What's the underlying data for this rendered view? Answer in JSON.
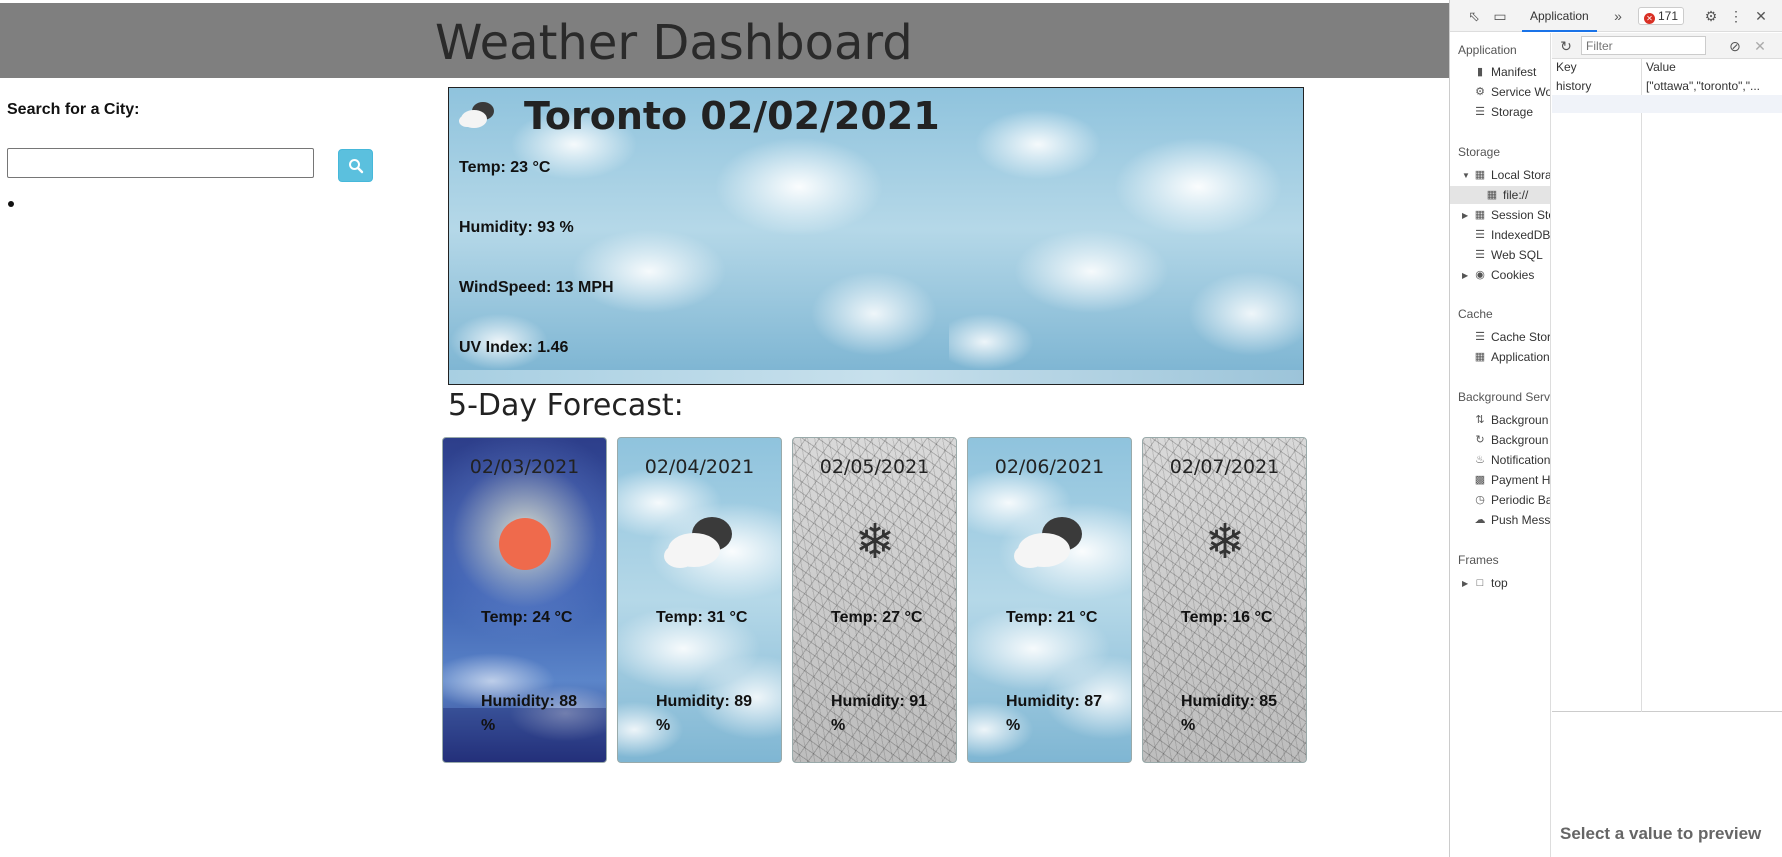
{
  "header": {
    "title": "Weather Dashboard"
  },
  "search": {
    "label": "Search for a City:",
    "placeholder": "",
    "value": "",
    "button_icon": "search-icon"
  },
  "current": {
    "title": "Toronto 02/02/2021",
    "icon": "cloud-icon",
    "temp": "Temp: 23 °C",
    "humidity": "Humidity: 93 %",
    "wind": "WindSpeed: 13 MPH",
    "uv": "UV Index: 1.46"
  },
  "forecast": {
    "title": "5-Day Forecast:",
    "days": [
      {
        "date": "02/03/2021",
        "icon": "sun-icon",
        "temp": "Temp: 24 °C",
        "humidity": "Humidity: 88 %",
        "theme": "sunny"
      },
      {
        "date": "02/04/2021",
        "icon": "cloud-icon",
        "temp": "Temp: 31 °C",
        "humidity": "Humidity: 89 %",
        "theme": "sky"
      },
      {
        "date": "02/05/2021",
        "icon": "snowflake-icon",
        "temp": "Temp: 27 °C",
        "humidity": "Humidity: 91 %",
        "theme": "snow"
      },
      {
        "date": "02/06/2021",
        "icon": "cloud-icon",
        "temp": "Temp: 21 °C",
        "humidity": "Humidity: 87 %",
        "theme": "sky"
      },
      {
        "date": "02/07/2021",
        "icon": "snowflake-icon",
        "temp": "Temp: 16 °C",
        "humidity": "Humidity: 85 %",
        "theme": "snow"
      }
    ]
  },
  "colors": {
    "header_bg": "#7f7f7f",
    "search_button": "#5bc0de",
    "sun": "#ef6a4c"
  },
  "devtools": {
    "active_tab": "Application",
    "more_tabs": "»",
    "error_count": "171",
    "sidebar": {
      "application": {
        "title": "Application",
        "items": [
          "Manifest",
          "Service Wo",
          "Storage"
        ]
      },
      "storage": {
        "title": "Storage",
        "local_storage": "Local Stora",
        "local_child": "file://",
        "items": [
          "Session Sto",
          "IndexedDB",
          "Web SQL",
          "Cookies"
        ]
      },
      "cache": {
        "title": "Cache",
        "items": [
          "Cache Stor",
          "Application"
        ]
      },
      "background": {
        "title": "Background Servi",
        "items": [
          "Backgroun",
          "Backgroun",
          "Notification",
          "Payment H",
          "Periodic Ba",
          "Push Mess"
        ]
      },
      "frames": {
        "title": "Frames",
        "items": [
          "top"
        ]
      }
    },
    "filter_placeholder": "Filter",
    "table": {
      "headers": [
        "Key",
        "Value"
      ],
      "rows": [
        {
          "key": "history",
          "value": "[\"ottawa\",\"toronto\",\"..."
        }
      ]
    },
    "preview_text": "Select a value to preview"
  }
}
